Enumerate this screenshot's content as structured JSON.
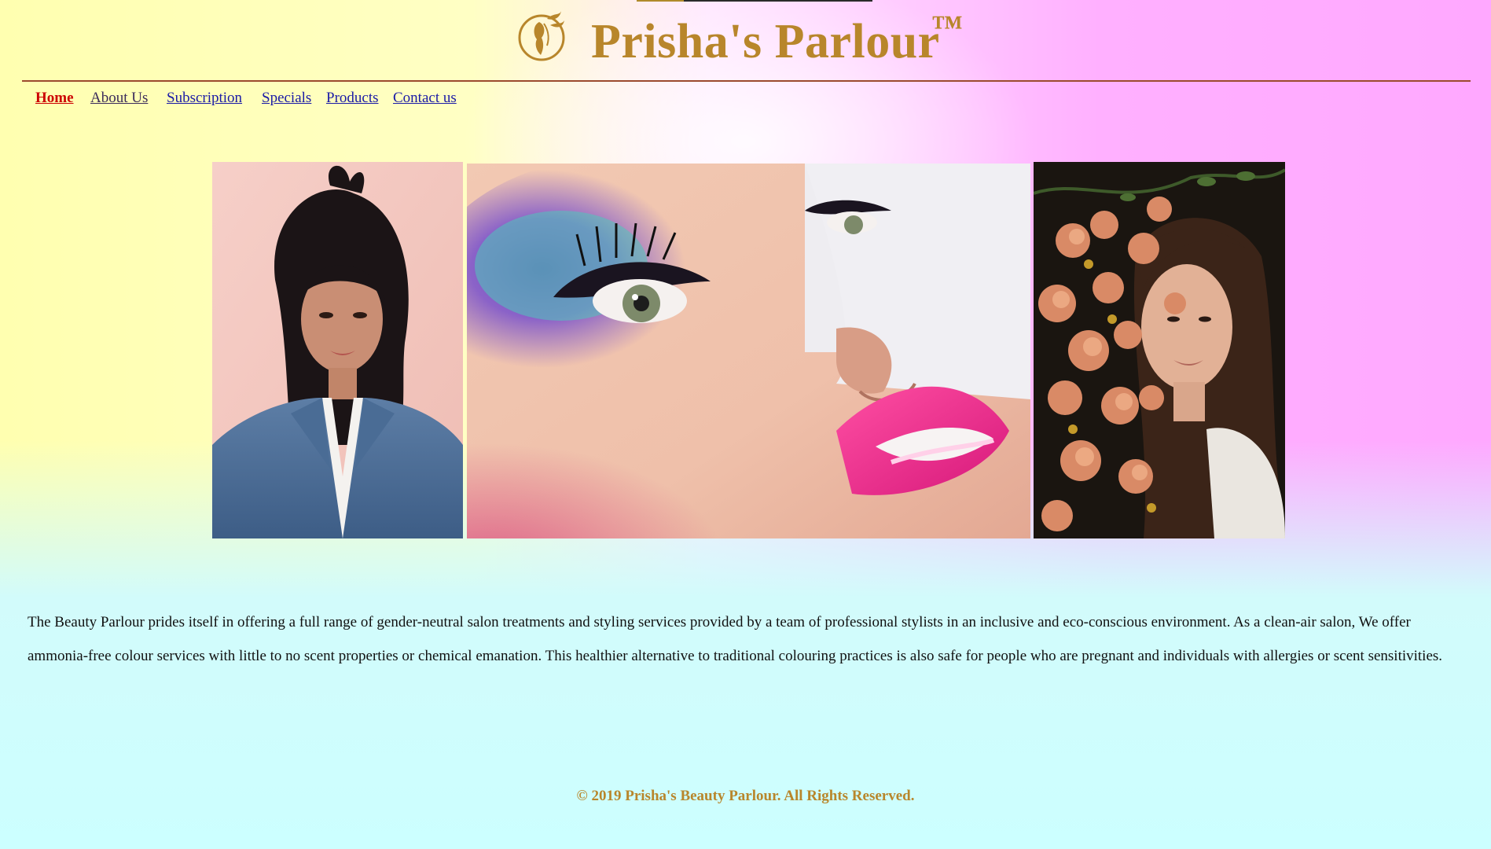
{
  "brand": {
    "name": "Prisha's Parlour",
    "trademark": "™"
  },
  "nav": {
    "items": [
      {
        "label": "Home",
        "state": "active"
      },
      {
        "label": "About Us",
        "state": "visited"
      },
      {
        "label": "Subscription",
        "state": "link"
      },
      {
        "label": "Specials",
        "state": "link"
      },
      {
        "label": "Products",
        "state": "link"
      },
      {
        "label": "Contact us",
        "state": "link"
      }
    ]
  },
  "gallery": {
    "images": [
      {
        "name": "woman-denim-jacket-photo"
      },
      {
        "name": "eye-makeup-pink-lips-photo"
      },
      {
        "name": "woman-with-flowers-photo"
      }
    ]
  },
  "intro": {
    "text": "The Beauty Parlour prides itself in offering a full range of gender-neutral salon treatments and styling services provided by a team of professional stylists in an inclusive and eco-conscious environment. As a clean-air salon, We offer ammonia-free colour services with little to no scent properties or chemical emanation. This healthier alternative to traditional colouring practices is also safe for people who are pregnant and individuals with allergies or scent sensitivities."
  },
  "footer": {
    "text": "© 2019 Prisha's Beauty Parlour. All Rights Reserved."
  },
  "colors": {
    "brand_gold": "#b8862b",
    "link": "#1a1aa6",
    "active_link": "#cc0000",
    "rule": "#9c4a2e"
  }
}
